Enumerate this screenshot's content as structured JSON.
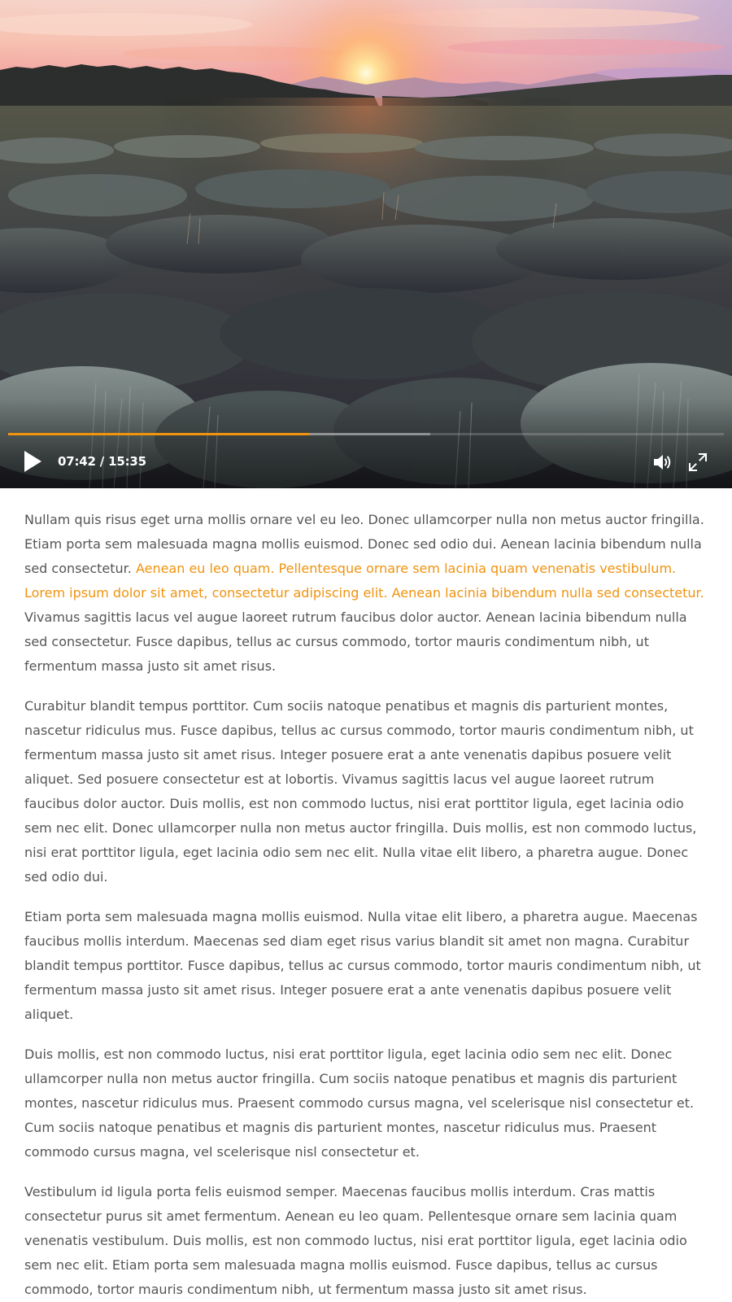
{
  "video": {
    "current_time": "07:42",
    "separator": "/",
    "duration": "15:35",
    "played_fraction": 0.42,
    "buffered_fraction": 0.59,
    "accent_color": "#f0930f",
    "play_icon": "play-icon",
    "volume_icon": "volume-icon",
    "fullscreen_icon": "fullscreen-icon"
  },
  "article": {
    "p1_before": "Nullam quis risus eget urna mollis ornare vel eu leo. Donec ullamcorper nulla non metus auctor fringilla. Etiam porta sem malesuada magna mollis euismod. Donec sed odio dui. Aenean lacinia bibendum nulla sed consectetur. ",
    "p1_highlight": "Aenean eu leo quam. Pellentesque ornare sem lacinia quam venenatis vestibulum. Lorem ipsum dolor sit amet, consectetur adipiscing elit. Aenean lacinia bibendum nulla sed consectetur.",
    "p1_after": " Vivamus sagittis lacus vel augue laoreet rutrum faucibus dolor auctor. Aenean lacinia bibendum nulla sed consectetur. Fusce dapibus, tellus ac cursus commodo, tortor mauris condimentum nibh, ut fermentum massa justo sit amet risus.",
    "p2": "Curabitur blandit tempus porttitor. Cum sociis natoque penatibus et magnis dis parturient montes, nascetur ridiculus mus. Fusce dapibus, tellus ac cursus commodo, tortor mauris condimentum nibh, ut fermentum massa justo sit amet risus. Integer posuere erat a ante venenatis dapibus posuere velit aliquet. Sed posuere consectetur est at lobortis. Vivamus sagittis lacus vel augue laoreet rutrum faucibus dolor auctor. Duis mollis, est non commodo luctus, nisi erat porttitor ligula, eget lacinia odio sem nec elit. Donec ullamcorper nulla non metus auctor fringilla. Duis mollis, est non commodo luctus, nisi erat porttitor ligula, eget lacinia odio sem nec elit. Nulla vitae elit libero, a pharetra augue. Donec sed odio dui.",
    "p3": "Etiam porta sem malesuada magna mollis euismod. Nulla vitae elit libero, a pharetra augue. Maecenas faucibus mollis interdum. Maecenas sed diam eget risus varius blandit sit amet non magna. Curabitur blandit tempus porttitor. Fusce dapibus, tellus ac cursus commodo, tortor mauris condimentum nibh, ut fermentum massa justo sit amet risus. Integer posuere erat a ante venenatis dapibus posuere velit aliquet.",
    "p4": "Duis mollis, est non commodo luctus, nisi erat porttitor ligula, eget lacinia odio sem nec elit. Donec ullamcorper nulla non metus auctor fringilla. Cum sociis natoque penatibus et magnis dis parturient montes, nascetur ridiculus mus. Praesent commodo cursus magna, vel scelerisque nisl consectetur et. Cum sociis natoque penatibus et magnis dis parturient montes, nascetur ridiculus mus. Praesent commodo cursus magna, vel scelerisque nisl consectetur et.",
    "p5": "Vestibulum id ligula porta felis euismod semper. Maecenas faucibus mollis interdum. Cras mattis consectetur purus sit amet fermentum. Aenean eu leo quam. Pellentesque ornare sem lacinia quam venenatis vestibulum. Duis mollis, est non commodo luctus, nisi erat porttitor ligula, eget lacinia odio sem nec elit. Etiam porta sem malesuada magna mollis euismod. Fusce dapibus, tellus ac cursus commodo, tortor mauris condimentum nibh, ut fermentum massa justo sit amet risus."
  }
}
